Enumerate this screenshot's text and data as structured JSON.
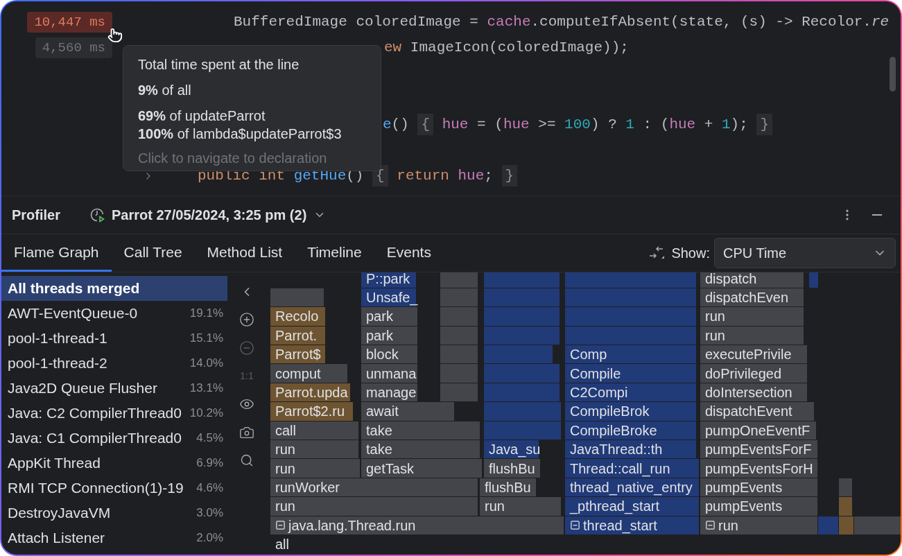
{
  "editor": {
    "timing_badges": [
      {
        "text": "10,447 ms",
        "hot": true
      },
      {
        "text": "4,560 ms",
        "hot": false
      }
    ],
    "code_lines": [
      {
        "tokens": [
          {
            "text": "BufferedImage coloredImage = ",
            "kind": "plain"
          },
          {
            "text": "cache",
            "kind": "field"
          },
          {
            "text": ".computeIfAbsent(state, (s) -> Recolor.",
            "kind": "plain"
          },
          {
            "text": "re",
            "kind": "italic"
          }
        ]
      },
      {
        "tokens": [
          {
            "text": "ew",
            "kind": "keyword"
          },
          {
            "text": " ImageIcon(coloredImage));",
            "kind": "plain"
          }
        ]
      },
      {
        "tokens": [
          {
            "text": "e",
            "kind": "method"
          },
          {
            "text": "() ",
            "kind": "plain"
          },
          {
            "text": "{",
            "kind": "brace"
          },
          {
            "text": " hue",
            "kind": "field"
          },
          {
            "text": " = (",
            "kind": "plain"
          },
          {
            "text": "hue",
            "kind": "field"
          },
          {
            "text": " >= ",
            "kind": "plain"
          },
          {
            "text": "100",
            "kind": "number"
          },
          {
            "text": ") ? ",
            "kind": "plain"
          },
          {
            "text": "1",
            "kind": "number"
          },
          {
            "text": " : (",
            "kind": "plain"
          },
          {
            "text": "hue",
            "kind": "field"
          },
          {
            "text": " + ",
            "kind": "plain"
          },
          {
            "text": "1",
            "kind": "number"
          },
          {
            "text": "); ",
            "kind": "plain"
          },
          {
            "text": "}",
            "kind": "brace"
          }
        ]
      },
      {
        "tokens": [
          {
            "text": "public int",
            "kind": "keyword"
          },
          {
            "text": " getHue",
            "kind": "method"
          },
          {
            "text": "() ",
            "kind": "plain"
          },
          {
            "text": "{",
            "kind": "brace"
          },
          {
            "text": " return",
            "kind": "keyword"
          },
          {
            "text": " hue",
            "kind": "field"
          },
          {
            "text": "; ",
            "kind": "plain"
          },
          {
            "text": "}",
            "kind": "brace"
          }
        ]
      }
    ],
    "tooltip": {
      "title": "Total time spent at the line",
      "lines": [
        "**9%** of all",
        "**69%** of updateParrot",
        "**100%** of lambda$updateParrot$3"
      ],
      "hint": "Click to navigate to declaration"
    }
  },
  "profiler": {
    "title": "Profiler",
    "snapshot": "Parrot 27/05/2024, 3:25 pm (2)"
  },
  "tabs": [
    {
      "label": "Flame Graph",
      "selected": true
    },
    {
      "label": "Call Tree",
      "selected": false
    },
    {
      "label": "Method List",
      "selected": false
    },
    {
      "label": "Timeline",
      "selected": false
    },
    {
      "label": "Events",
      "selected": false
    }
  ],
  "show": {
    "label": "Show:",
    "value": "CPU Time"
  },
  "threads": [
    {
      "name": "All threads merged",
      "selected": true
    },
    {
      "name": "AWT-EventQueue-0",
      "percent": "19.1%",
      "selected": false
    },
    {
      "name": "pool-1-thread-1",
      "percent": "15.1%",
      "selected": false
    },
    {
      "name": "pool-1-thread-2",
      "percent": "14.0%",
      "selected": false
    },
    {
      "name": "Java2D Queue Flusher",
      "percent": "13.1%",
      "selected": false
    },
    {
      "name": "Java: C2 CompilerThread0",
      "percent": "10.2%",
      "selected": false
    },
    {
      "name": "Java: C1 CompilerThread0",
      "percent": "4.5%",
      "selected": false
    },
    {
      "name": "AppKit Thread",
      "percent": "6.9%",
      "selected": false
    },
    {
      "name": "RMI TCP Connection(1)-19",
      "percent": "4.6%",
      "selected": false
    },
    {
      "name": "DestroyJavaVM",
      "percent": "3.0%",
      "selected": false
    },
    {
      "name": "Attach Listener",
      "percent": "2.0%",
      "selected": false
    }
  ],
  "toolbar": [
    {
      "kind": "back",
      "disabled": false
    },
    {
      "kind": "zoom_in",
      "disabled": false
    },
    {
      "kind": "zoom_out",
      "disabled": true
    },
    {
      "kind": "reset",
      "label": "1:1",
      "disabled": true
    },
    {
      "kind": "eye",
      "disabled": false
    },
    {
      "kind": "camera",
      "disabled": false
    },
    {
      "kind": "search",
      "disabled": false
    }
  ],
  "flame_graph": {
    "rows": [
      {
        "frames": [
          {
            "label": "P::park",
            "kind": "native"
          },
          {
            "kind": "lib"
          },
          {
            "kind": "native"
          },
          {
            "kind": "native"
          },
          {
            "label": "dispatch",
            "kind": "lib"
          },
          {
            "kind": "native"
          }
        ]
      },
      {
        "frames": [
          {
            "kind": "lib"
          },
          {
            "label": "Unsafe_",
            "kind": "native"
          },
          {
            "kind": "lib"
          },
          {
            "kind": "native"
          },
          {
            "kind": "native"
          },
          {
            "label": "dispatchEven",
            "kind": "lib"
          }
        ]
      },
      {
        "frames": [
          {
            "label": "Recolo",
            "kind": "java"
          },
          {
            "label": "park",
            "kind": "lib"
          },
          {
            "kind": "lib"
          },
          {
            "kind": "native"
          },
          {
            "kind": "native"
          },
          {
            "label": "run",
            "kind": "lib"
          }
        ]
      },
      {
        "frames": [
          {
            "label": "Parrot.",
            "kind": "java"
          },
          {
            "label": "park",
            "kind": "lib"
          },
          {
            "kind": "lib"
          },
          {
            "kind": "native"
          },
          {
            "kind": "native"
          },
          {
            "label": "run",
            "kind": "lib"
          }
        ]
      },
      {
        "frames": [
          {
            "label": "Parrot$",
            "kind": "java"
          },
          {
            "label": "block",
            "kind": "lib"
          },
          {
            "kind": "lib"
          },
          {
            "kind": "native"
          },
          {
            "label": "Comp",
            "kind": "native"
          },
          {
            "label": "executePrivile",
            "kind": "lib"
          }
        ]
      },
      {
        "frames": [
          {
            "label": "comput",
            "kind": "lib"
          },
          {
            "label": "unmana",
            "kind": "lib"
          },
          {
            "kind": "lib"
          },
          {
            "kind": "native"
          },
          {
            "label": "Compile",
            "kind": "native"
          },
          {
            "label": "doPrivileged",
            "kind": "lib"
          }
        ]
      },
      {
        "frames": [
          {
            "label": "Parrot.upda",
            "kind": "java"
          },
          {
            "label": "manage",
            "kind": "lib"
          },
          {
            "kind": "lib"
          },
          {
            "kind": "native"
          },
          {
            "label": "C2Compi",
            "kind": "native"
          },
          {
            "label": "doIntersection",
            "kind": "lib"
          }
        ]
      },
      {
        "frames": [
          {
            "label": "Parrot$2.ru",
            "kind": "java"
          },
          {
            "label": "await",
            "kind": "lib"
          },
          {
            "kind": "native"
          },
          {
            "label": "CompileBrok",
            "kind": "native"
          },
          {
            "label": "dispatchEvent",
            "kind": "lib"
          }
        ]
      },
      {
        "frames": [
          {
            "label": "call",
            "kind": "lib"
          },
          {
            "label": "take",
            "kind": "lib"
          },
          {
            "kind": "native"
          },
          {
            "label": "CompileBroke",
            "kind": "native"
          },
          {
            "label": "pumpOneEventF",
            "kind": "lib"
          }
        ]
      },
      {
        "frames": [
          {
            "label": "run",
            "kind": "lib"
          },
          {
            "label": "take",
            "kind": "lib"
          },
          {
            "label": "Java_su",
            "kind": "native"
          },
          {
            "label": "JavaThread::th",
            "kind": "native"
          },
          {
            "label": "pumpEventsForF",
            "kind": "lib"
          }
        ]
      },
      {
        "frames": [
          {
            "label": "run",
            "kind": "lib"
          },
          {
            "label": "getTask",
            "kind": "lib"
          },
          {
            "label": "flushBu",
            "kind": "lib"
          },
          {
            "label": "Thread::call_run",
            "kind": "native"
          },
          {
            "label": "pumpEventsForH",
            "kind": "lib"
          }
        ]
      },
      {
        "frames": [
          {
            "label": "runWorker",
            "kind": "lib"
          },
          {
            "label": "flushBu",
            "kind": "lib"
          },
          {
            "label": "thread_native_entry",
            "kind": "native"
          },
          {
            "label": "pumpEvents",
            "kind": "lib"
          },
          {
            "kind": "lib"
          }
        ]
      },
      {
        "frames": [
          {
            "label": "run",
            "kind": "lib"
          },
          {
            "label": "run",
            "kind": "lib"
          },
          {
            "label": "_pthread_start",
            "kind": "native"
          },
          {
            "label": "pumpEvents",
            "kind": "lib"
          },
          {
            "kind": "java"
          }
        ]
      },
      {
        "frames": [
          {
            "label": "java.lang.Thread.run",
            "kind": "lib",
            "expanded": true
          },
          {
            "label": "thread_start",
            "kind": "native",
            "expanded": true
          },
          {
            "label": "run",
            "kind": "lib",
            "expanded": true
          },
          {
            "kind": "native"
          },
          {
            "kind": "java"
          },
          {
            "kind": "lib"
          }
        ]
      },
      {
        "frames": [
          {
            "label": "all",
            "kind": "root"
          }
        ]
      }
    ]
  }
}
